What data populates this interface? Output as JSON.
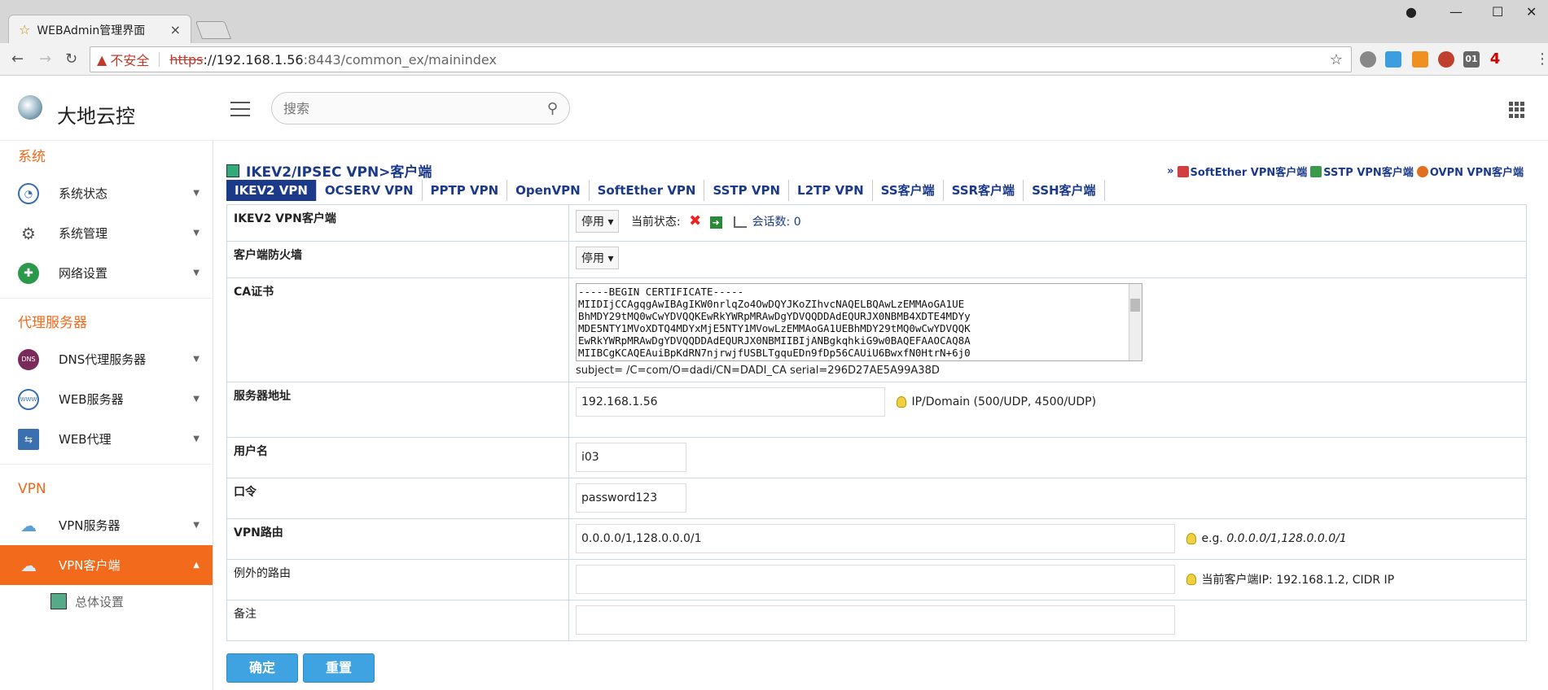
{
  "browser": {
    "tab_title": "WEBAdmin管理界面",
    "tab_close": "×",
    "insecure_label": "不安全",
    "url_proto": "https",
    "url_host": "://192.168.1.56",
    "url_rest": ":8443/common_ex/mainindex",
    "ext_labels": [
      "01",
      "4"
    ]
  },
  "header": {
    "logo_text": "大地云控",
    "search_placeholder": "搜索"
  },
  "sidebar": {
    "groups": [
      {
        "label": "系统",
        "items": [
          {
            "label": "系统状态",
            "icon": "gauge-icon"
          },
          {
            "label": "系统管理",
            "icon": "gears-icon"
          },
          {
            "label": "网络设置",
            "icon": "network-icon"
          }
        ]
      },
      {
        "label": "代理服务器",
        "items": [
          {
            "label": "DNS代理服务器",
            "icon": "dns-icon"
          },
          {
            "label": "WEB服务器",
            "icon": "www-icon"
          },
          {
            "label": "WEB代理",
            "icon": "monitor-icon"
          }
        ]
      },
      {
        "label": "VPN",
        "items": [
          {
            "label": "VPN服务器",
            "icon": "cloud-bolt-icon"
          },
          {
            "label": "VPN客户端",
            "icon": "cloud-icon"
          }
        ]
      }
    ],
    "sub_item": "总体设置"
  },
  "main": {
    "title": "IKEV2/IPSEC VPN>客户端",
    "top_links": [
      "SoftEther VPN客户端",
      "SSTP VPN客户端",
      "OVPN VPN客户端"
    ],
    "top_links_prefix": "»",
    "tabs": [
      "IKEV2 VPN",
      "OCSERV VPN",
      "PPTP VPN",
      "OpenVPN",
      "SoftEther VPN",
      "SSTP VPN",
      "L2TP VPN",
      "SS客户端",
      "SSR客户端",
      "SSH客户端"
    ],
    "rows": {
      "client_label": "IKEV2 VPN客户端",
      "client_select": "停用 ▾",
      "status_label": "当前状态:",
      "sessions": "会话数: 0",
      "firewall_label": "客户端防火墙",
      "firewall_select": "停用 ▾",
      "ca_label": "CA证书",
      "ca_text": "-----BEGIN CERTIFICATE-----\nMIIDIjCCAgqgAwIBAgIKW0nrlqZo4OwDQYJKoZIhvcNAQELBQAwLzEMMAoGA1UE\nBhMDY29tMQ0wCwYDVQQKEwRkYWRpMRAwDgYDVQQDDAdEQURJX0NBMB4XDTE4MDYy\nMDE5NTY1MVoXDTQ4MDYxMjE5NTY1MVowLzEMMAoGA1UEBhMDY29tMQ0wCwYDVQQK\nEwRkYWRpMRAwDgYDVQQDDAdEQURJX0NBMIIBIjANBgkqhkiG9w0BAQEFAAOCAQ8A\nMIIBCgKCAQEAuiBpKdRN7njrwjfUSBLTgquEDn9fDp56CAUiU6BwxfN0HtrN+6j0",
      "ca_subject": "subject= /C=com/O=dadi/CN=DADI_CA serial=296D27AE5A99A38D",
      "server_label": "服务器地址",
      "server_value": "192.168.1.56",
      "server_hint": "IP/Domain (500/UDP, 4500/UDP)",
      "user_label": "用户名",
      "user_value": "i03",
      "pass_label": "口令",
      "pass_value": "password123",
      "route_label": "VPN路由",
      "route_value": "0.0.0.0/1,128.0.0.0/1",
      "route_hint_prefix": "e.g.",
      "route_hint": "0.0.0.0/1,128.0.0.0/1",
      "except_label": "例外的路由",
      "except_value": "",
      "except_hint": "当前客户端IP: 192.168.1.2, CIDR IP",
      "note_label": "备注",
      "note_value": ""
    },
    "buttons": {
      "confirm": "确定",
      "reset": "重置"
    }
  },
  "colors": {
    "accent": "#f26a1b",
    "link": "#1c3a8a",
    "button": "#3ea3e0"
  }
}
